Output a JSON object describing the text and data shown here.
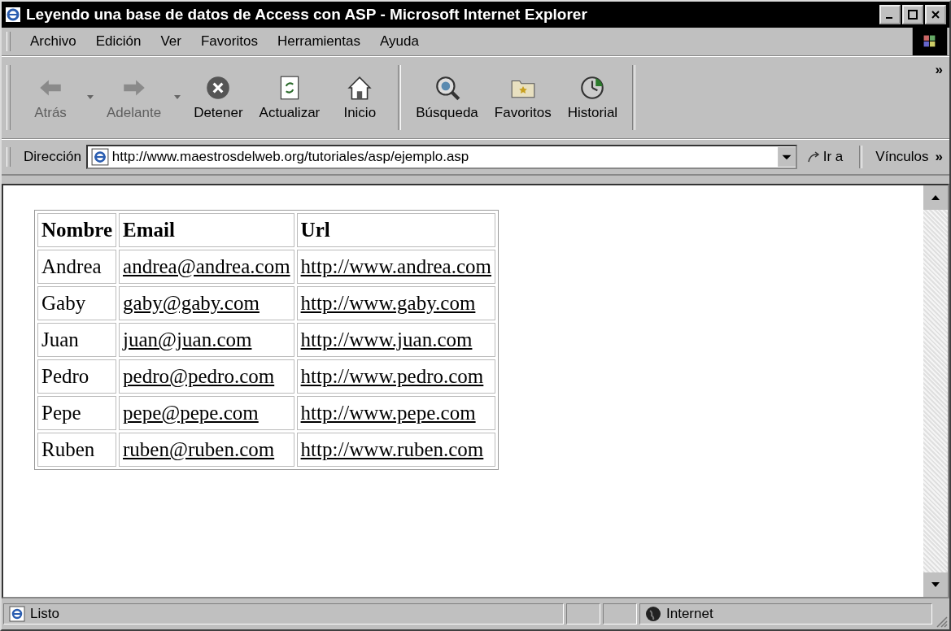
{
  "window": {
    "title": "Leyendo una base de datos de Access con ASP - Microsoft Internet Explorer"
  },
  "menu": [
    "Archivo",
    "Edición",
    "Ver",
    "Favoritos",
    "Herramientas",
    "Ayuda"
  ],
  "toolbar": [
    {
      "kind": "back",
      "label": "Atrás",
      "disabled": true,
      "dropdown": true
    },
    {
      "kind": "forward",
      "label": "Adelante",
      "disabled": true,
      "dropdown": true
    },
    {
      "kind": "stop",
      "label": "Detener",
      "disabled": false,
      "dropdown": false
    },
    {
      "kind": "refresh",
      "label": "Actualizar",
      "disabled": false,
      "dropdown": false
    },
    {
      "kind": "home",
      "label": "Inicio",
      "disabled": false,
      "dropdown": false
    },
    {
      "kind": "search",
      "label": "Búsqueda",
      "disabled": false,
      "dropdown": false
    },
    {
      "kind": "favorites",
      "label": "Favoritos",
      "disabled": false,
      "dropdown": false
    },
    {
      "kind": "history",
      "label": "Historial",
      "disabled": false,
      "dropdown": false
    }
  ],
  "toolbar_more": "»",
  "address": {
    "label": "Dirección",
    "value": "http://www.maestrosdelweb.org/tutoriales/asp/ejemplo.asp",
    "go": "Ir a",
    "links": "Vínculos",
    "links_more": "»"
  },
  "table": {
    "columns": [
      "Nombre",
      "Email",
      "Url"
    ],
    "rows": [
      [
        "Andrea",
        "andrea@andrea.com",
        "http://www.andrea.com"
      ],
      [
        "Gaby",
        "gaby@gaby.com",
        "http://www.gaby.com"
      ],
      [
        "Juan",
        "juan@juan.com",
        "http://www.juan.com"
      ],
      [
        "Pedro",
        "pedro@pedro.com",
        "http://www.pedro.com"
      ],
      [
        "Pepe",
        "pepe@pepe.com",
        "http://www.pepe.com"
      ],
      [
        "Ruben",
        "ruben@ruben.com",
        "http://www.ruben.com"
      ]
    ]
  },
  "status_bar": {
    "text": "Listo",
    "zone": "Internet"
  }
}
